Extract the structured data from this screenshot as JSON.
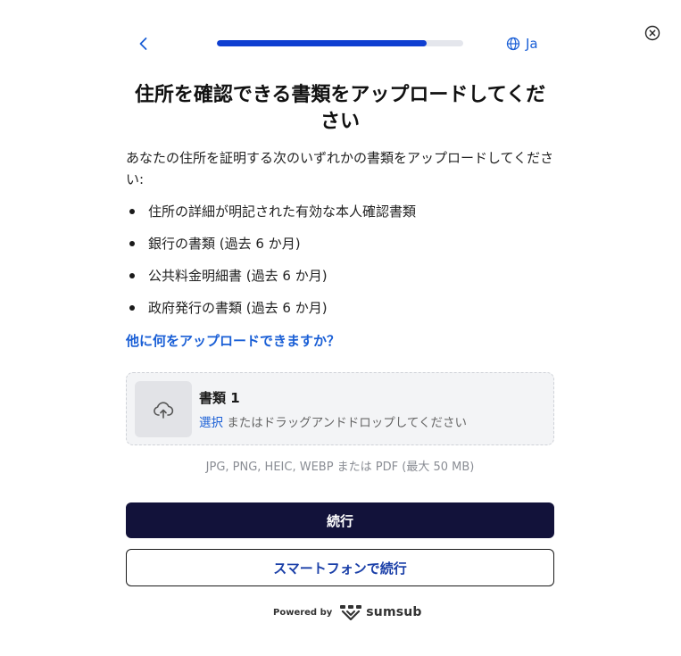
{
  "header": {
    "progress": 0.85,
    "language": "Ja"
  },
  "content": {
    "title": "住所を確認できる書類をアップロードしてください",
    "description": "あなたの住所を証明する次のいずれかの書類をアップロードしてください:",
    "document_types": [
      "住所の詳細が明記された有効な本人確認書類",
      "銀行の書類 (過去 6 か月)",
      "公共料金明細書 (過去 6 か月)",
      "政府発行の書類 (過去 6 か月)"
    ],
    "help_link": "他に何をアップロードできますか？"
  },
  "upload": {
    "title": "書類 1",
    "select_label": "選択",
    "drag_text": " またはドラッグアンドドロップしてください",
    "formats": "JPG, PNG, HEIC, WEBP または PDF (最大 50 MB)"
  },
  "actions": {
    "continue_label": "続行",
    "phone_label": "スマートフォンで続行"
  },
  "footer": {
    "powered_by": "Powered by",
    "brand": "sumsub"
  },
  "colors": {
    "accent": "#1a5fd6",
    "progress_fill": "#0f3fd1",
    "primary_button": "#12123a"
  }
}
